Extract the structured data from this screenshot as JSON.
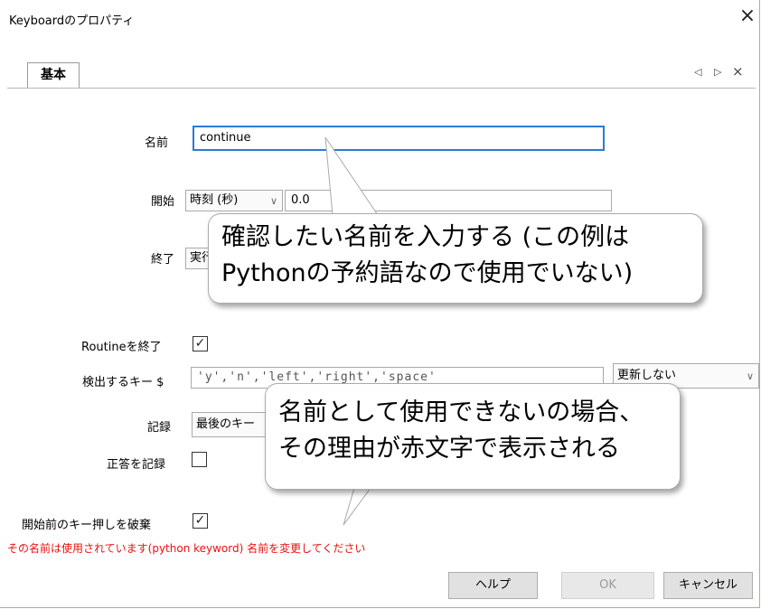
{
  "window": {
    "title": "Keyboardのプロパティ"
  },
  "tabs": [
    {
      "label": "基本"
    }
  ],
  "fields": {
    "name": {
      "label": "名前",
      "value": "continue"
    },
    "start": {
      "label": "開始",
      "type": "時刻 (秒)",
      "value": "0.0"
    },
    "end": {
      "label": "終了",
      "type": "実行"
    },
    "end_routine": {
      "label": "Routineを終了",
      "checked": true
    },
    "keys": {
      "label": "検出するキー $",
      "value": "'y','n','left','right','space'",
      "update": "更新しない"
    },
    "store": {
      "label": "記録",
      "value": "最後のキー"
    },
    "store_correct": {
      "label": "正答を記録",
      "checked": false
    },
    "discard_prev": {
      "label": "開始前のキー押しを破棄",
      "checked": true
    }
  },
  "error_message": "その名前は使用されています(python keyword) 名前を変更してください",
  "buttons": {
    "help": "ヘルプ",
    "ok": "OK",
    "cancel": "キャンセル"
  },
  "callouts": {
    "top": [
      "確認したい名前を入力する (この例は",
      "Pythonの予約語なので使用でいない)"
    ],
    "bottom": [
      "名前として使用できないの場合、",
      "その理由が赤文字で表示される"
    ]
  },
  "icons": {
    "close": "×",
    "checkmark": "☑",
    "chevron": "∨",
    "tab_prev": "◁",
    "tab_next": "▷"
  },
  "colors": {
    "error": "#ee1111",
    "focus": "#2a7bd6",
    "border": "#8ec08e"
  }
}
